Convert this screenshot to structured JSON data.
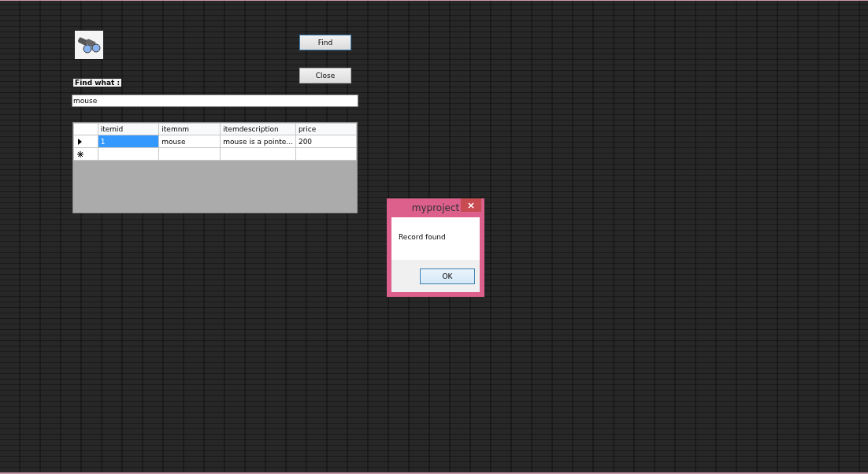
{
  "find_buttons": [
    "Find",
    "Close"
  ],
  "find_label": "Find what :",
  "search": {
    "value": "mouse"
  },
  "table": {
    "columns": [
      "itemid",
      "itemnm",
      "itemdescription",
      "price"
    ],
    "rows": [
      {
        "kind": "current",
        "cells": [
          {
            "text": "1",
            "selected": true
          },
          {
            "text": "mouse",
            "selected": false
          },
          {
            "text": "mouse is a pointe...",
            "selected": false
          },
          {
            "text": "200",
            "selected": false
          }
        ]
      },
      {
        "kind": "new",
        "cells": []
      }
    ]
  },
  "dialog": {
    "title": "myproject",
    "message": "Record found",
    "button": "OK"
  }
}
